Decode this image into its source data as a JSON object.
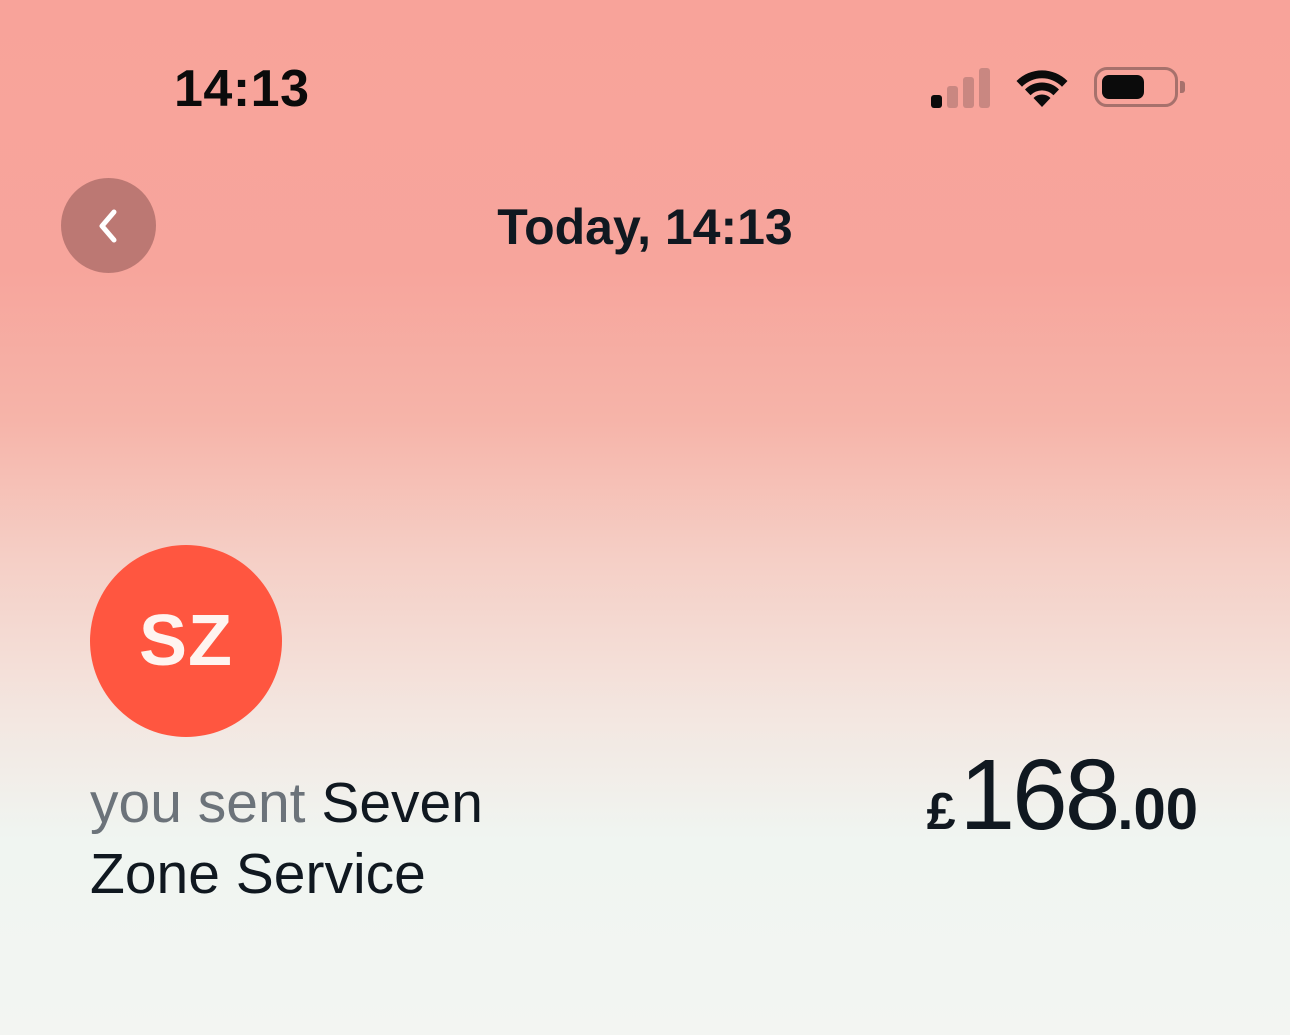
{
  "status_bar": {
    "time": "14:13",
    "signal_bars_active": 1,
    "signal_bars_total": 4,
    "battery_level": 0.5,
    "icons": [
      "cellular-signal-icon",
      "wifi-icon",
      "battery-icon"
    ]
  },
  "header": {
    "back_icon": "chevron-left-icon",
    "title": "Today, 14:13"
  },
  "transaction": {
    "avatar_initials": "SZ",
    "avatar_color": "#ff5640",
    "prefix": "you sent",
    "recipient": "Seven Zone Service",
    "amount": {
      "currency_symbol": "£",
      "major": "168",
      "minor": ".00"
    }
  }
}
